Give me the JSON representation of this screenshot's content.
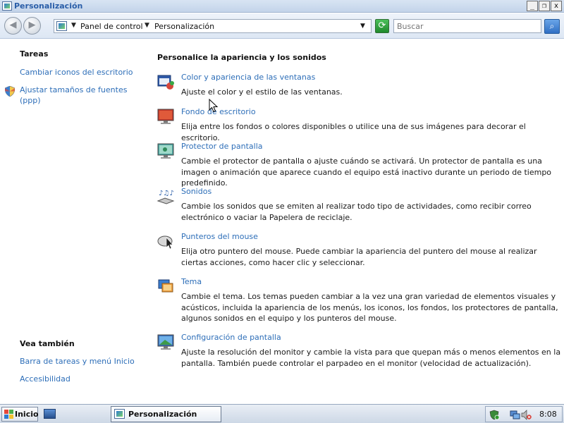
{
  "window": {
    "title": "Personalización",
    "min_label": "_",
    "max_label": "❐",
    "close_label": "x"
  },
  "addressbar": {
    "back_label": "◀",
    "forward_label": "▶",
    "breadcrumb": [
      "Panel de control",
      "Personalización"
    ],
    "search_placeholder": "Buscar"
  },
  "sidebar": {
    "tasks_heading": "Tareas",
    "tasks": [
      {
        "label": "Cambiar iconos del escritorio"
      },
      {
        "label": "Ajustar tamaños de fuentes (ppp)",
        "icon": "shield-icon"
      }
    ],
    "see_also_heading": "Vea también",
    "see_also": [
      {
        "label": "Barra de tareas y menú Inicio"
      },
      {
        "label": "Accesibilidad"
      }
    ]
  },
  "main": {
    "heading": "Personalice la apariencia y los sonidos",
    "items": [
      {
        "title": "Color y apariencia de las ventanas",
        "desc": "Ajuste el color y el estilo de las ventanas.",
        "icon": "window-color-icon"
      },
      {
        "title": "Fondo de escritorio",
        "desc": "Elija entre los fondos o colores disponibles o utilice una de sus imágenes para decorar el escritorio.",
        "icon": "desktop-background-icon"
      },
      {
        "title": "Protector de pantalla",
        "desc": "Cambie el protector de pantalla o ajuste cuándo se activará. Un protector de pantalla es una imagen o animación que aparece cuando el equipo está inactivo durante un periodo de tiempo predefinido.",
        "icon": "screensaver-icon"
      },
      {
        "title": "Sonidos",
        "desc": "Cambie los sonidos que se emiten al realizar todo tipo de actividades, como recibir correo electrónico o vaciar la Papelera de reciclaje.",
        "icon": "sounds-icon"
      },
      {
        "title": "Punteros del mouse",
        "desc": "Elija otro puntero del mouse. Puede cambiar la apariencia del puntero del mouse al realizar ciertas acciones, como hacer clic y seleccionar.",
        "icon": "mouse-pointer-icon"
      },
      {
        "title": "Tema",
        "desc": "Cambie el tema. Los temas pueden cambiar a la vez una gran variedad de elementos visuales y acústicos, incluida la apariencia de los menús, los iconos, los fondos, los protectores de pantalla, algunos sonidos en el equipo y los punteros del mouse.",
        "icon": "theme-icon"
      },
      {
        "title": "Configuración de pantalla",
        "desc": "Ajuste la resolución del monitor y cambie la vista para que quepan más o menos elementos en la pantalla. También puede controlar el parpadeo en el monitor (velocidad de actualización).",
        "icon": "display-settings-icon"
      }
    ]
  },
  "taskbar": {
    "start_label": "Inicio",
    "active_window": "Personalización",
    "clock": "8:08"
  }
}
